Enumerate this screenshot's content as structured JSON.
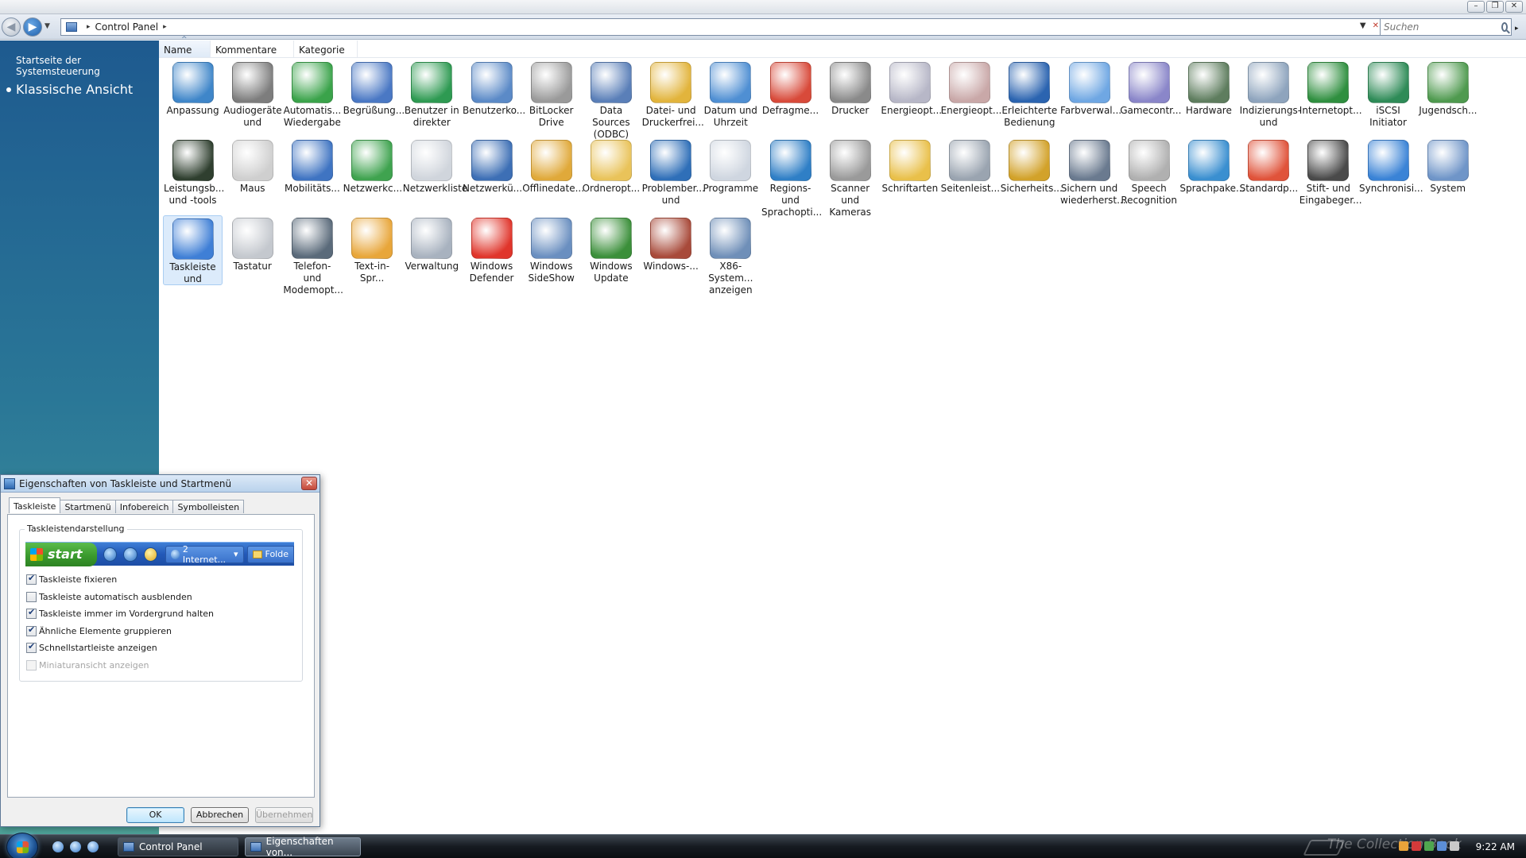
{
  "window": {
    "controls": [
      "–",
      "❐",
      "✕"
    ]
  },
  "address_bar": {
    "path": [
      "Control Panel"
    ],
    "search_placeholder": "Suchen"
  },
  "left_pane": {
    "home_link": "Startseite der Systemsteuerung",
    "current_view": "Klassische Ansicht"
  },
  "columns": [
    "Name",
    "Kommentare",
    "Kategorie"
  ],
  "items": [
    {
      "label": "Anpassung",
      "icon": "personalization-icon",
      "color": "#3f86c9"
    },
    {
      "label": "Audiogeräte und",
      "icon": "speaker-icon",
      "color": "#7d7d7d"
    },
    {
      "label": "Automatis... Wiedergabe",
      "icon": "autoplay-icon",
      "color": "#3aa34a"
    },
    {
      "label": "Begrüßung...",
      "icon": "welcome-center-icon",
      "color": "#4a78c4"
    },
    {
      "label": "Benutzer in direkter",
      "icon": "parental-users-icon",
      "color": "#2e9a52"
    },
    {
      "label": "Benutzerko...",
      "icon": "user-accounts-icon",
      "color": "#5b8ac7"
    },
    {
      "label": "BitLocker Drive",
      "icon": "bitlocker-icon",
      "color": "#9a9a9a"
    },
    {
      "label": "Data Sources (ODBC)",
      "icon": "data-sources-icon",
      "color": "#5a7fb8"
    },
    {
      "label": "Datei- und Druckerfrei...",
      "icon": "file-sharing-icon",
      "color": "#e2b43c"
    },
    {
      "label": "Datum und Uhrzeit",
      "icon": "clock-icon",
      "color": "#4f8fd3"
    },
    {
      "label": "Defragme...",
      "icon": "defrag-icon",
      "color": "#d84a3a"
    },
    {
      "label": "Drucker",
      "icon": "printer-icon",
      "color": "#8a8a8a"
    },
    {
      "label": "Energieopt...",
      "icon": "power-options-icon",
      "color": "#b7b7c7"
    },
    {
      "label": "Energieopt...",
      "icon": "power-options-icon",
      "color": "#c9a8a8"
    },
    {
      "label": "Erleichterte Bedienung",
      "icon": "ease-of-access-icon",
      "color": "#2b64b0"
    },
    {
      "label": "Farbverwal...",
      "icon": "color-management-icon",
      "color": "#6fa7e3"
    },
    {
      "label": "Gamecontr...",
      "icon": "gamepad-icon",
      "color": "#8a86c9"
    },
    {
      "label": "Hardware",
      "icon": "hardware-icon",
      "color": "#5e7d5e"
    },
    {
      "label": "Indizierungs- und",
      "icon": "indexing-icon",
      "color": "#8ea4bd"
    },
    {
      "label": "Internetopt...",
      "icon": "internet-options-icon",
      "color": "#2f8f3f"
    },
    {
      "label": "iSCSI Initiator",
      "icon": "iscsi-icon",
      "color": "#2e8b57"
    },
    {
      "label": "Jugendsch...",
      "icon": "parental-controls-icon",
      "color": "#4f9a4f"
    },
    {
      "label": "Leistungsb... und -tools",
      "icon": "performance-icon",
      "color": "#2f3f2f"
    },
    {
      "label": "Maus",
      "icon": "mouse-icon",
      "color": "#cfcfcf"
    },
    {
      "label": "Mobilitäts...",
      "icon": "mobility-center-icon",
      "color": "#3f74c2"
    },
    {
      "label": "Netzwerkc...",
      "icon": "network-center-icon",
      "color": "#3fa34f"
    },
    {
      "label": "Netzwerkliste",
      "icon": "network-list-icon",
      "color": "#d0d5dc"
    },
    {
      "label": "Netzwerkü...",
      "icon": "network-map-icon",
      "color": "#3d6fb5"
    },
    {
      "label": "Offlinedate...",
      "icon": "offline-files-icon",
      "color": "#e0a93a"
    },
    {
      "label": "Ordneropt...",
      "icon": "folder-options-icon",
      "color": "#e9c35a"
    },
    {
      "label": "Problember... und",
      "icon": "problem-reports-icon",
      "color": "#2f6fb8"
    },
    {
      "label": "Programme",
      "icon": "programs-icon",
      "color": "#cfd6e0"
    },
    {
      "label": "Regions- und Sprachopti...",
      "icon": "globe-icon",
      "color": "#2f7fc6"
    },
    {
      "label": "Scanner und Kameras",
      "icon": "camera-icon",
      "color": "#9a9a9a"
    },
    {
      "label": "Schriftarten",
      "icon": "fonts-folder-icon",
      "color": "#e9c04a"
    },
    {
      "label": "Seitenleist...",
      "icon": "gear-icon",
      "color": "#9aa4b0"
    },
    {
      "label": "Sicherheits...",
      "icon": "shield-icon",
      "color": "#d2a22a"
    },
    {
      "label": "Sichern und wiederherst...",
      "icon": "backup-icon",
      "color": "#6a7a8f"
    },
    {
      "label": "Speech Recognition",
      "icon": "microphone-icon",
      "color": "#b0b0b0"
    },
    {
      "label": "Sprachpake...",
      "icon": "language-pack-icon",
      "color": "#3a8fd0"
    },
    {
      "label": "Standardp...",
      "icon": "default-programs-icon",
      "color": "#e0533a"
    },
    {
      "label": "Stift- und Eingabeger...",
      "icon": "pen-icon",
      "color": "#4a4a4a"
    },
    {
      "label": "Synchronisi...",
      "icon": "sync-icon",
      "color": "#3a83d6"
    },
    {
      "label": "System",
      "icon": "system-icon",
      "color": "#6f95c8"
    },
    {
      "label": "Taskleiste und",
      "icon": "taskbar-icon",
      "color": "#3f7fd6",
      "selected": true
    },
    {
      "label": "Tastatur",
      "icon": "keyboard-icon",
      "color": "#c4c8ce"
    },
    {
      "label": "Telefon- und Modemopt...",
      "icon": "phone-modem-icon",
      "color": "#5a6a7a"
    },
    {
      "label": "Text-in-Spr...",
      "icon": "text-to-speech-icon",
      "color": "#e8a63a"
    },
    {
      "label": "Verwaltung",
      "icon": "admin-tools-icon",
      "color": "#a8b2bf"
    },
    {
      "label": "Windows Defender",
      "icon": "windows-defender-icon",
      "color": "#e0352b"
    },
    {
      "label": "Windows SideShow",
      "icon": "sideshow-icon",
      "color": "#6a8fc0"
    },
    {
      "label": "Windows Update",
      "icon": "windows-update-icon",
      "color": "#3b8f3a"
    },
    {
      "label": "Windows-...",
      "icon": "firewall-icon",
      "color": "#a84a3a"
    },
    {
      "label": "X86-System... anzeigen",
      "icon": "x86-system-icon",
      "color": "#6f8fb8"
    }
  ],
  "dialog": {
    "title": "Eigenschaften von Taskleiste und Startmenü",
    "tabs": [
      "Taskleiste",
      "Startmenü",
      "Infobereich",
      "Symbolleisten"
    ],
    "group_title": "Taskleistendarstellung",
    "preview": {
      "start_label": "start",
      "task1": "2 Internet...",
      "task2": "Folde"
    },
    "options": [
      {
        "label": "Taskleiste fixieren",
        "checked": true,
        "disabled": false
      },
      {
        "label": "Taskleiste automatisch ausblenden",
        "checked": false,
        "disabled": false
      },
      {
        "label": "Taskleiste immer im Vordergrund halten",
        "checked": true,
        "disabled": false
      },
      {
        "label": "Ähnliche Elemente gruppieren",
        "checked": true,
        "disabled": false
      },
      {
        "label": "Schnellstartleiste anzeigen",
        "checked": true,
        "disabled": false
      },
      {
        "label": "Miniaturansicht anzeigen",
        "checked": false,
        "disabled": true
      }
    ],
    "buttons": {
      "ok": "OK",
      "cancel": "Abbrechen",
      "apply": "Übernehmen"
    }
  },
  "taskbar": {
    "tasks": [
      {
        "label": "Control Panel",
        "active": false
      },
      {
        "label": "Eigenschaften von...",
        "active": true
      }
    ],
    "watermark": "The Collection Book",
    "clock": "9:22 AM"
  }
}
